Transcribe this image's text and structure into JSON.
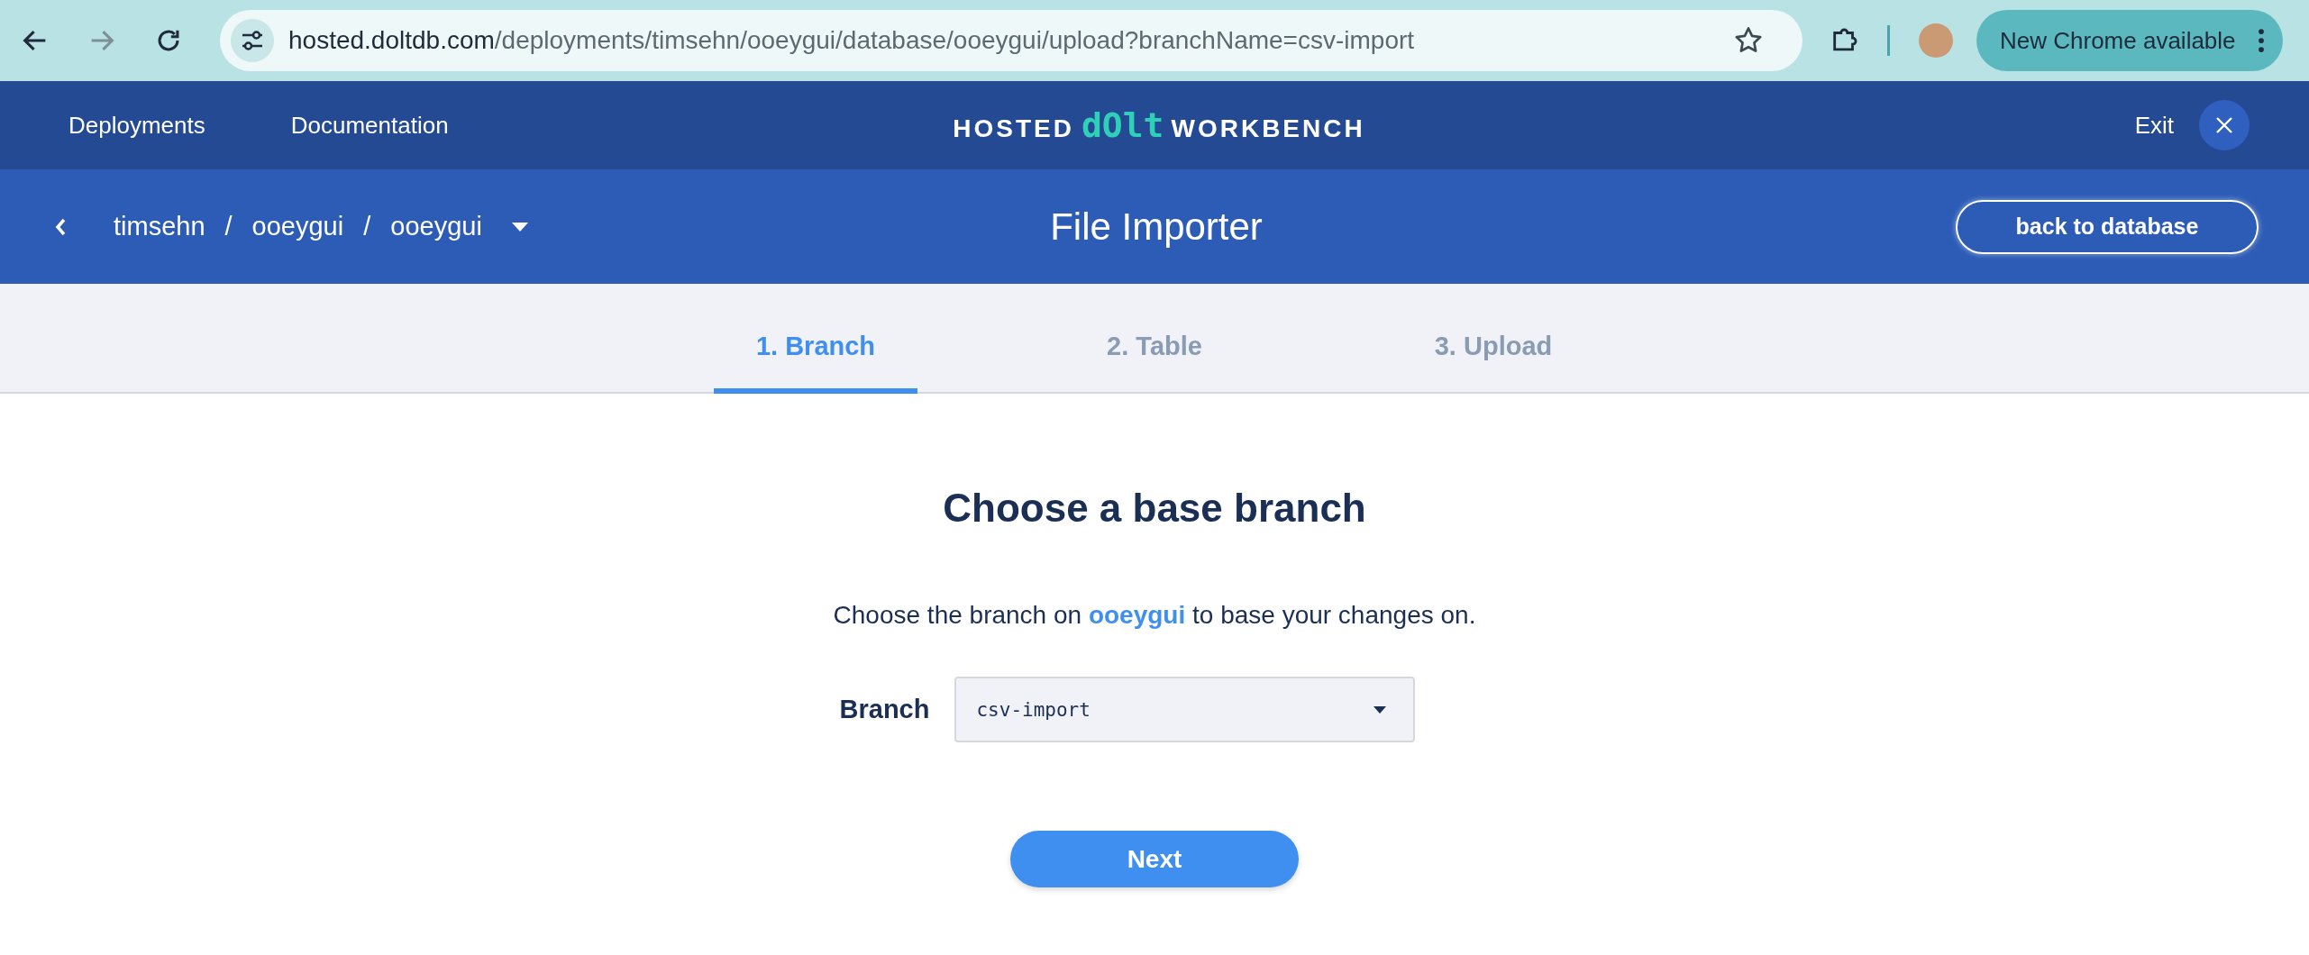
{
  "browser": {
    "url": {
      "host": "hosted.doltdb.com",
      "path": "/deployments/timsehn/ooeygui/database/ooeygui/upload?branchName=csv-import"
    },
    "forward_disabled": true,
    "update_button": "New Chrome available"
  },
  "header": {
    "nav": [
      "Deployments",
      "Documentation"
    ],
    "logo": {
      "left": "HOSTED",
      "middle": "dOlt",
      "right": "WORKBENCH"
    },
    "exit": "Exit"
  },
  "subheader": {
    "breadcrumb": [
      "timsehn",
      "ooeygui",
      "ooeygui"
    ],
    "separator": "/",
    "title": "File Importer",
    "back_button": "back to database"
  },
  "tabs": [
    {
      "label": "1. Branch",
      "selected": true
    },
    {
      "label": "2. Table",
      "selected": false
    },
    {
      "label": "3. Upload",
      "selected": false
    }
  ],
  "content": {
    "heading": "Choose a base branch",
    "description": {
      "before": "Choose the branch on",
      "link": "ooeygui",
      "after": "to base your changes on."
    },
    "field_label": "Branch",
    "field_value": "csv-import",
    "next_button": "Next"
  }
}
